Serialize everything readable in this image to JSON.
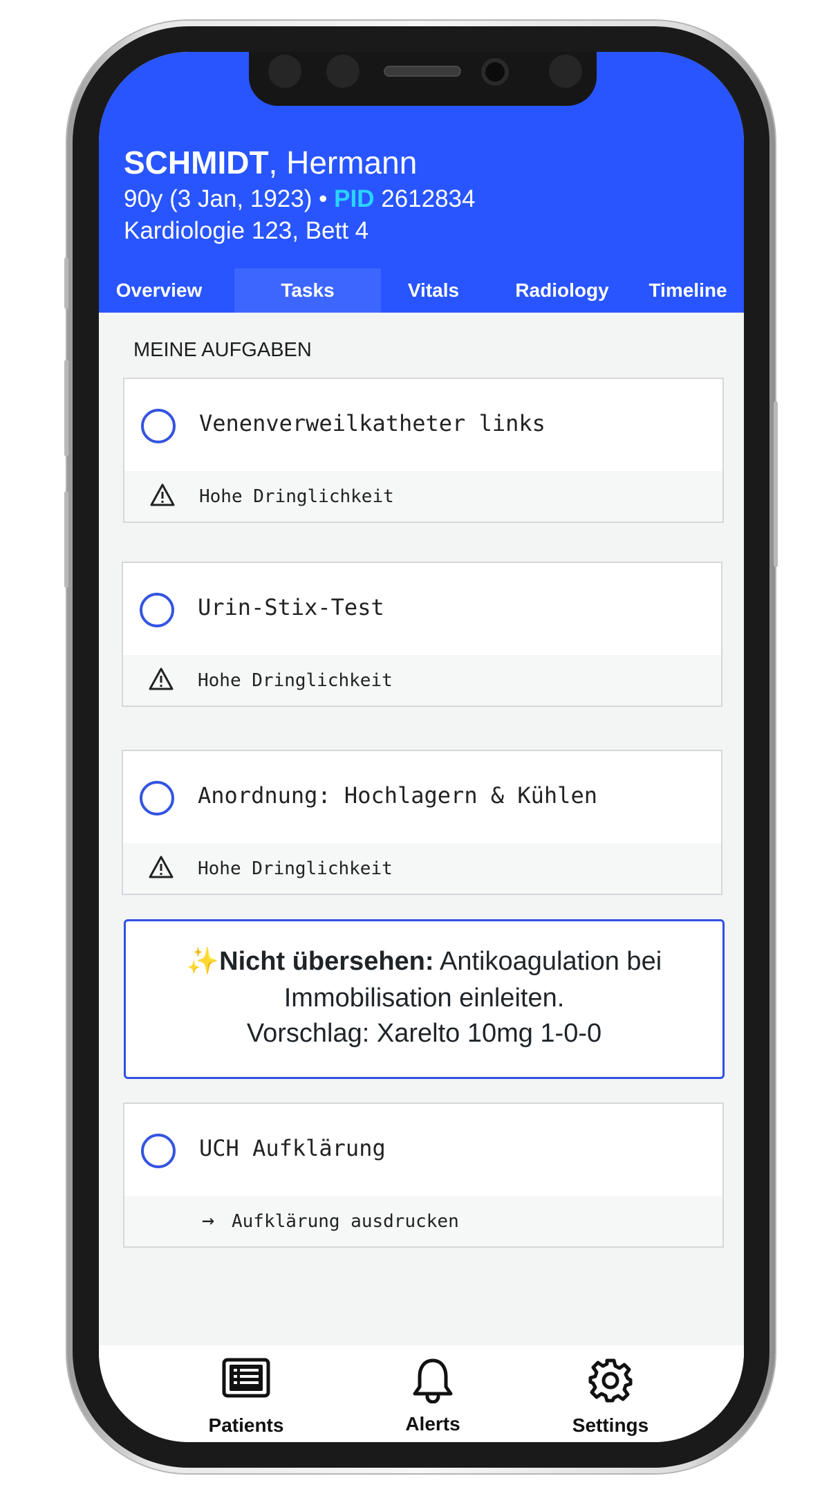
{
  "patient": {
    "last_name": "SCHMIDT",
    "name_sep": ",",
    "first_name": "Hermann",
    "age_dob": "90y (3 Jan, 1923)",
    "bullet": "•",
    "pid_label": "PID",
    "pid": "2612834",
    "location": "Kardiologie 123, Bett 4"
  },
  "tabs": [
    {
      "label": "Overview"
    },
    {
      "label": "Tasks",
      "active": true
    },
    {
      "label": "Vitals"
    },
    {
      "label": "Radiology"
    },
    {
      "label": "Timeline"
    }
  ],
  "section_title": "MEINE AUFGABEN",
  "tasks": [
    {
      "title": "Venenverweilkatheter links",
      "sub": "Hohe Dringlichkeit",
      "sub_icon": "warning-icon"
    },
    {
      "title": "Urin-Stix-Test",
      "sub": "Hohe Dringlichkeit",
      "sub_icon": "warning-icon"
    },
    {
      "title": "Anordnung: Hochlagern & Kühlen",
      "sub": "Hohe Dringlichkeit",
      "sub_icon": "warning-icon"
    },
    {
      "title": "UCH Aufklärung",
      "sub": "Aufklärung ausdrucken",
      "sub_icon": "arrow-right-icon",
      "sub_arrow": "→"
    }
  ],
  "hint": {
    "sparkle": "✨",
    "strong": "Nicht übersehen:",
    "line1_rest": "Antikoagulation bei",
    "line2": "Immobilisation einleiten.",
    "line3": "Vorschlag: Xarelto 10mg 1-0-0"
  },
  "tabbar": [
    {
      "label": "Patients",
      "icon": "patients-list-icon"
    },
    {
      "label": "Alerts",
      "icon": "bell-icon"
    },
    {
      "label": "Settings",
      "icon": "gear-icon"
    }
  ],
  "colors": {
    "header_blue": "#2855ff",
    "pid_cyan": "#2ad4ff",
    "accent_blue": "#3454e0"
  }
}
